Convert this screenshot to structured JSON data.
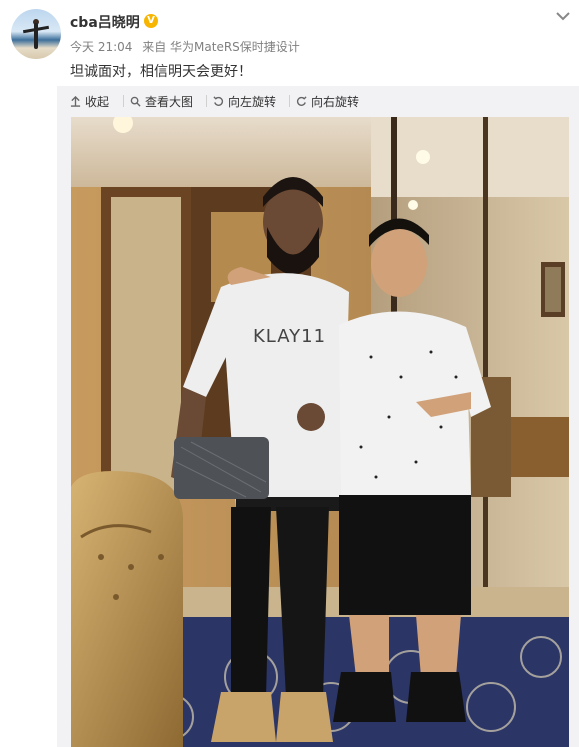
{
  "post": {
    "username": "cba吕晓明",
    "verified_icon": "verified-badge-icon",
    "time": "今天 21:04",
    "source": "来自 华为MateRS保时捷设计",
    "text": "坦诚面对，相信明天会更好！"
  },
  "toolbar": {
    "collapse_label": "收起",
    "view_large_label": "查看大图",
    "rotate_left_label": "向左旋转",
    "rotate_right_label": "向右旋转"
  },
  "photo": {
    "shirt_text": "KLAY11"
  },
  "colors": {
    "verified": "#f7b500",
    "meta": "#808080",
    "panel": "#f2f2f5"
  }
}
